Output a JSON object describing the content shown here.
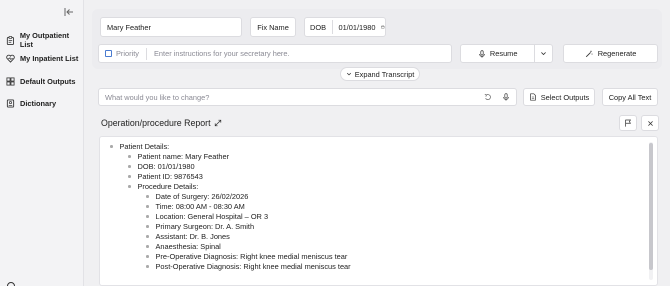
{
  "sidebar": {
    "items": [
      {
        "label": "My Outpatient List",
        "icon": "clipboard-icon"
      },
      {
        "label": "My Inpatient List",
        "icon": "heartbeat-icon"
      },
      {
        "label": "Default Outputs",
        "icon": "layout-icon"
      },
      {
        "label": "Dictionary",
        "icon": "book-icon"
      }
    ]
  },
  "patient": {
    "name": "Mary Feather",
    "fix_name_label": "Fix Name",
    "dob_label": "DOB",
    "dob_value": "01/01/1980"
  },
  "instructions": {
    "priority_label": "Priority",
    "placeholder": "Enter instructions for your secretary here."
  },
  "actions": {
    "resume_label": "Resume",
    "regenerate_label": "Regenerate",
    "expand_transcript_label": "Expand Transcript"
  },
  "change": {
    "placeholder": "What would you like to change?",
    "select_outputs_label": "Select Outputs",
    "copy_all_label": "Copy All Text"
  },
  "report": {
    "title": "Operation/procedure Report",
    "lines": [
      "Patient Details:",
      "Patient name: Mary Feather",
      "DOB: 01/01/1980",
      "Patient ID: 9876543",
      "Procedure Details:",
      "Date of Surgery: 26/02/2026",
      "Time: 08:00 AM - 08:30 AM",
      "Location: General Hospital – OR 3",
      "Primary Surgeon: Dr. A. Smith",
      "Assistant: Dr. B. Jones",
      "Anaesthesia: Spinal",
      "Pre-Operative Diagnosis: Right knee medial meniscus tear",
      "Post-Operative Diagnosis: Right knee medial meniscus tear"
    ]
  }
}
